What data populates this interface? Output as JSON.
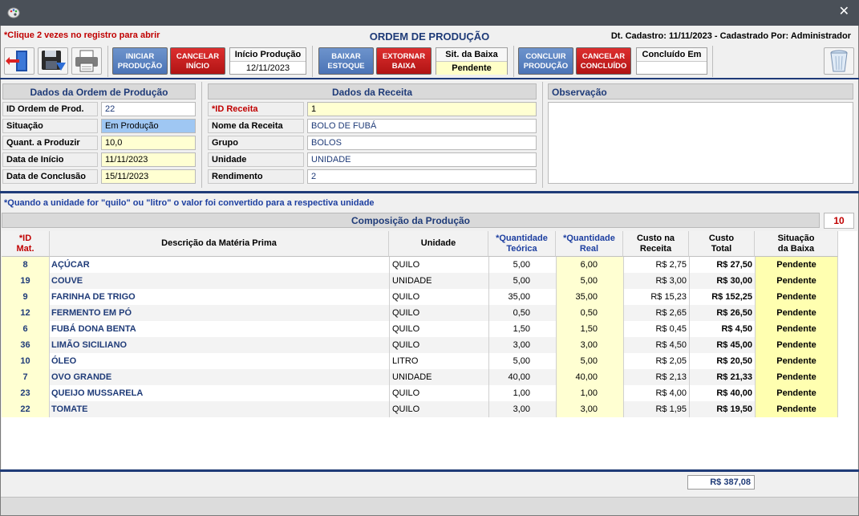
{
  "window": {
    "close_glyph": "✕"
  },
  "header": {
    "hint": "*Clique 2 vezes no registro para abrir",
    "title": "ORDEM DE PRODUÇÃO",
    "cad_info": "Dt. Cadastro: 11/11/2023 - Cadastrado Por: Administrador"
  },
  "toolbar": {
    "icons": {
      "exit": "exit-door-icon",
      "save": "floppy-save-icon",
      "print": "printer-icon",
      "trash": "trash-bin-icon"
    },
    "iniciar_producao": [
      "INICIAR",
      "PRODUÇÃO"
    ],
    "cancelar_inicio": [
      "CANCELAR",
      "INÍCIO"
    ],
    "inicio_producao_label": "Início Produção",
    "inicio_producao_value": "12/11/2023",
    "baixar_estoque": [
      "BAIXAR",
      "ESTOQUE"
    ],
    "extornar_baixa": [
      "EXTORNAR",
      "BAIXA"
    ],
    "sit_baixa_label": "Sit. da Baixa",
    "sit_baixa_value": "Pendente",
    "concluir_producao": [
      "CONCLUIR",
      "PRODUÇÃO"
    ],
    "cancelar_concluido": [
      "CANCELAR",
      "CONCLUÍDO"
    ],
    "concluido_em_label": "Concluído Em",
    "concluido_em_value": ""
  },
  "ordem": {
    "title": "Dados da Ordem de Produção",
    "fields": [
      {
        "label": "ID Ordem de Prod.",
        "value": "22"
      },
      {
        "label": "Situação",
        "value": "Em Produção"
      },
      {
        "label": "Quant. a Produzir",
        "value": "10,0"
      },
      {
        "label": "Data de Início",
        "value": "11/11/2023"
      },
      {
        "label": "Data de Conclusão",
        "value": "15/11/2023"
      }
    ]
  },
  "receita": {
    "title": "Dados da Receita",
    "fields": [
      {
        "label": "*ID Receita",
        "value": "1"
      },
      {
        "label": "Nome da Receita",
        "value": "BOLO DE FUBÁ"
      },
      {
        "label": "Grupo",
        "value": "BOLOS"
      },
      {
        "label": "Unidade",
        "value": "UNIDADE"
      },
      {
        "label": "Rendimento",
        "value": "2"
      }
    ]
  },
  "observacao": {
    "title": "Observação",
    "value": ""
  },
  "note": "*Quando a unidade for \"quilo\" ou \"litro\" o valor foi convertido para a respectiva unidade",
  "composicao": {
    "title": "Composição da Produção",
    "count": "10",
    "columns": {
      "id": [
        "*ID",
        "Mat."
      ],
      "desc": "Descrição da Matéria Prima",
      "unit": "Unidade",
      "qt": [
        "*Quantidade",
        "Teórica"
      ],
      "qr": [
        "*Quantidade",
        "Real"
      ],
      "cr": [
        "Custo na",
        "Receita"
      ],
      "ct": [
        "Custo",
        "Total"
      ],
      "sit": [
        "Situação",
        "da Baixa"
      ]
    },
    "rows": [
      {
        "id": "8",
        "desc": "AÇÚCAR",
        "unit": "QUILO",
        "qt": "5,00",
        "qr": "6,00",
        "cr": "R$ 2,75",
        "ct": "R$ 27,50",
        "sit": "Pendente"
      },
      {
        "id": "19",
        "desc": "COUVE",
        "unit": "UNIDADE",
        "qt": "5,00",
        "qr": "5,00",
        "cr": "R$ 3,00",
        "ct": "R$ 30,00",
        "sit": "Pendente"
      },
      {
        "id": "9",
        "desc": "FARINHA DE TRIGO",
        "unit": "QUILO",
        "qt": "35,00",
        "qr": "35,00",
        "cr": "R$ 15,23",
        "ct": "R$ 152,25",
        "sit": "Pendente"
      },
      {
        "id": "12",
        "desc": "FERMENTO EM PÓ",
        "unit": "QUILO",
        "qt": "0,50",
        "qr": "0,50",
        "cr": "R$ 2,65",
        "ct": "R$ 26,50",
        "sit": "Pendente"
      },
      {
        "id": "6",
        "desc": "FUBÁ DONA BENTA",
        "unit": "QUILO",
        "qt": "1,50",
        "qr": "1,50",
        "cr": "R$ 0,45",
        "ct": "R$ 4,50",
        "sit": "Pendente"
      },
      {
        "id": "36",
        "desc": "LIMÃO SICILIANO",
        "unit": "QUILO",
        "qt": "3,00",
        "qr": "3,00",
        "cr": "R$ 4,50",
        "ct": "R$ 45,00",
        "sit": "Pendente"
      },
      {
        "id": "10",
        "desc": "ÓLEO",
        "unit": "LITRO",
        "qt": "5,00",
        "qr": "5,00",
        "cr": "R$ 2,05",
        "ct": "R$ 20,50",
        "sit": "Pendente"
      },
      {
        "id": "7",
        "desc": "OVO GRANDE",
        "unit": "UNIDADE",
        "qt": "40,00",
        "qr": "40,00",
        "cr": "R$ 2,13",
        "ct": "R$ 21,33",
        "sit": "Pendente"
      },
      {
        "id": "23",
        "desc": "QUEIJO MUSSARELA",
        "unit": "QUILO",
        "qt": "1,00",
        "qr": "1,00",
        "cr": "R$ 4,00",
        "ct": "R$ 40,00",
        "sit": "Pendente"
      },
      {
        "id": "22",
        "desc": "TOMATE",
        "unit": "QUILO",
        "qt": "3,00",
        "qr": "3,00",
        "cr": "R$ 1,95",
        "ct": "R$ 19,50",
        "sit": "Pendente"
      }
    ],
    "total": "R$ 387,08"
  }
}
